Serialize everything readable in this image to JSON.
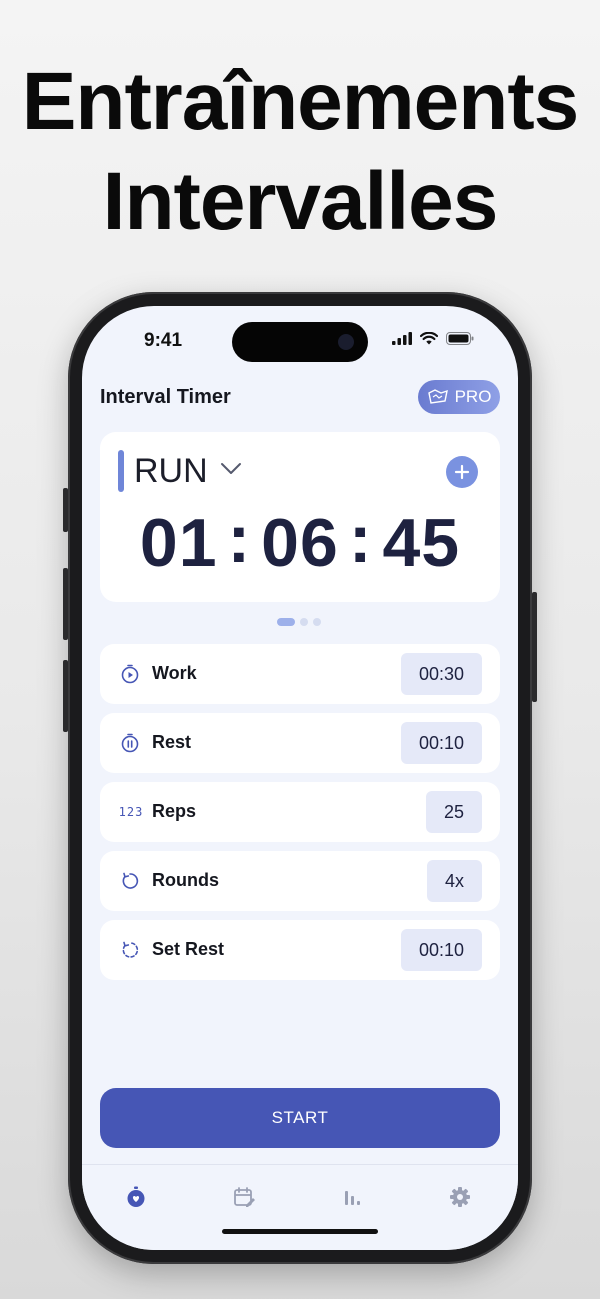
{
  "headline": {
    "line1": "Entraînements",
    "line2": "Intervalles"
  },
  "status_bar": {
    "time": "9:41",
    "icons": [
      "signal-icon",
      "wifi-icon",
      "battery-icon"
    ]
  },
  "header": {
    "title": "Interval Timer",
    "pro_label": "PRO"
  },
  "timer_card": {
    "workout_name": "RUN",
    "hours": "01",
    "minutes": "06",
    "seconds": "45",
    "separator": ":"
  },
  "pager": {
    "count": 3,
    "active_index": 0
  },
  "settings": [
    {
      "icon": "play-timer-icon",
      "label": "Work",
      "value": "00:30"
    },
    {
      "icon": "pause-timer-icon",
      "label": "Rest",
      "value": "00:10"
    },
    {
      "icon": "numbers-icon",
      "label": "Reps",
      "value": "25",
      "icon_text": "123"
    },
    {
      "icon": "rotate-icon",
      "label": "Rounds",
      "value": "4x"
    },
    {
      "icon": "dashed-rotate-icon",
      "label": "Set Rest",
      "value": "00:10"
    }
  ],
  "start_button": {
    "label": "START"
  },
  "tabbar": {
    "items": [
      {
        "icon": "timer-heart-icon",
        "active": true
      },
      {
        "icon": "calendar-edit-icon",
        "active": false
      },
      {
        "icon": "bar-chart-icon",
        "active": false
      },
      {
        "icon": "gear-icon",
        "active": false
      }
    ]
  },
  "colors": {
    "accent": "#4656b5",
    "accent_light": "#7a92e0",
    "background": "#f1f4fc",
    "value_pill": "#e5e9f8",
    "timer_text": "#1e2240"
  }
}
